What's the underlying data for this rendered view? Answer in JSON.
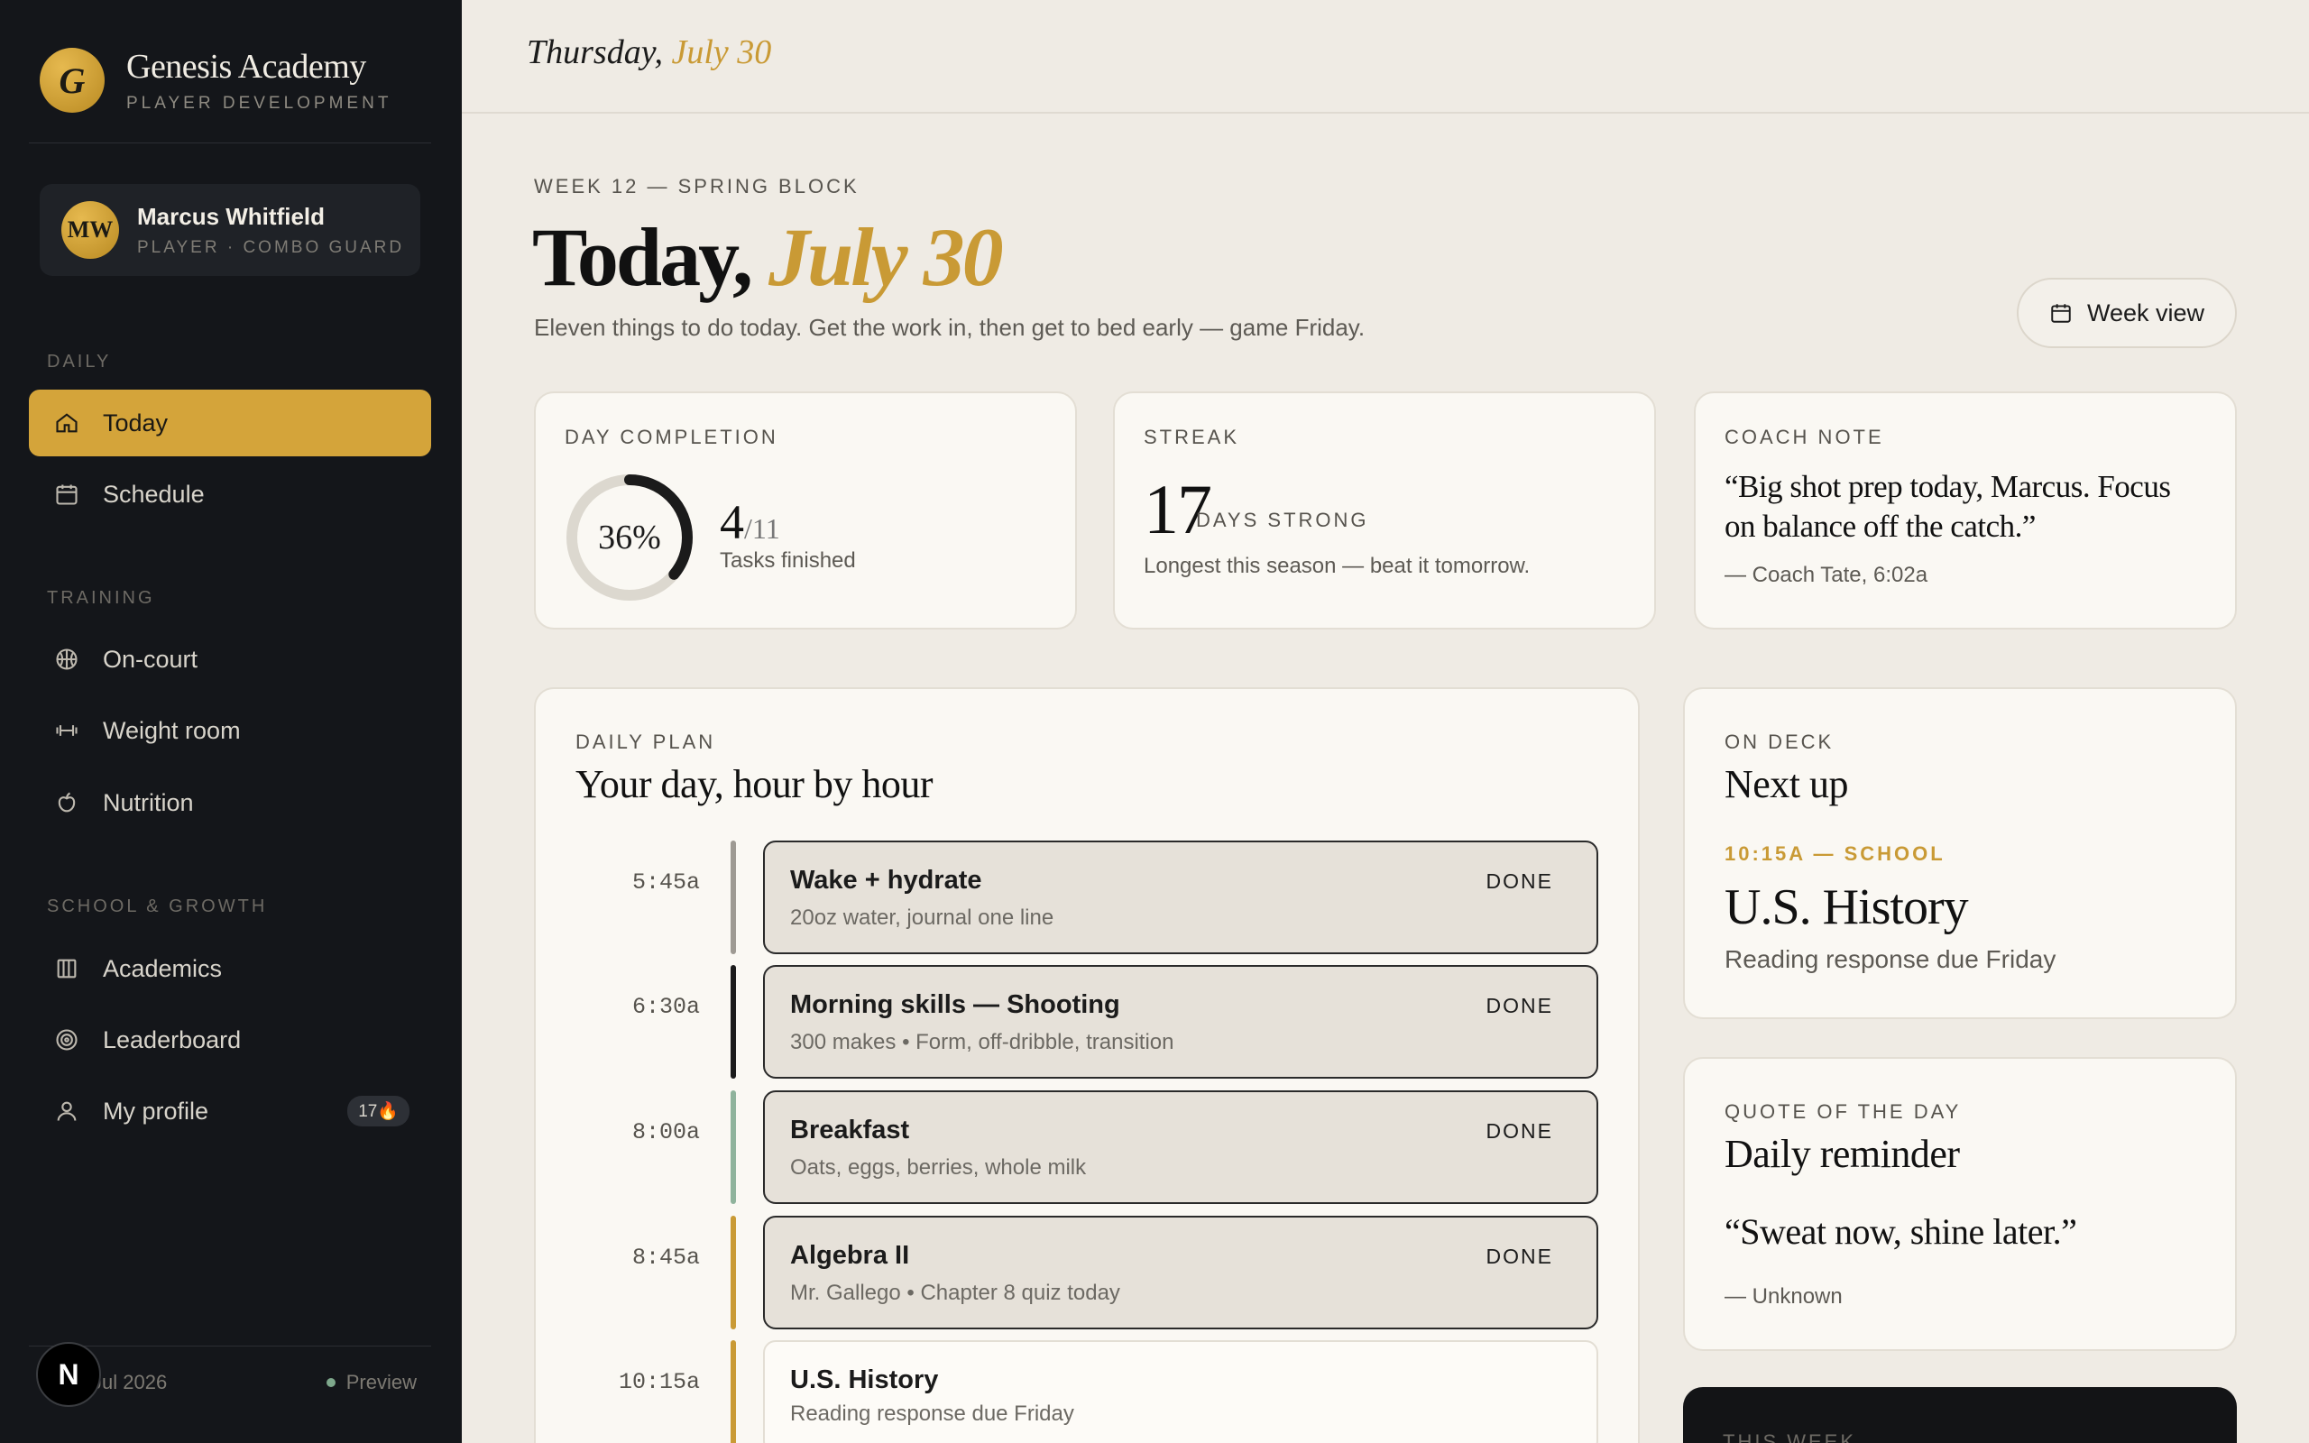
{
  "brand": {
    "logo_letter": "G",
    "name": "Genesis Academy",
    "subtitle": "PLAYER DEVELOPMENT"
  },
  "user": {
    "initials": "MW",
    "name": "Marcus Whitfield",
    "role": "PLAYER · COMBO GUARD"
  },
  "sidebar": {
    "sections": [
      {
        "label": "DAILY"
      },
      {
        "label": "TRAINING"
      },
      {
        "label": "SCHOOL & GROWTH"
      }
    ],
    "items": [
      {
        "label": "Today",
        "icon": "home-icon",
        "active": true
      },
      {
        "label": "Schedule",
        "icon": "calendar-icon"
      },
      {
        "label": "On-court",
        "icon": "basketball-icon"
      },
      {
        "label": "Weight room",
        "icon": "dumbbell-icon"
      },
      {
        "label": "Nutrition",
        "icon": "apple-icon"
      },
      {
        "label": "Academics",
        "icon": "book-icon"
      },
      {
        "label": "Leaderboard",
        "icon": "target-icon"
      },
      {
        "label": "My profile",
        "icon": "user-icon",
        "badge": "17🔥"
      }
    ],
    "footer": {
      "left": "Jul 2026",
      "right": "Preview",
      "n_button": "N"
    }
  },
  "topbar": {
    "weekday": "Thursday,",
    "date": "July 30"
  },
  "hero": {
    "eyebrow": "WEEK 12 — SPRING BLOCK",
    "title_prefix": "Today,",
    "title_accent": "July 30",
    "subtitle": "Eleven things to do today. Get the work in, then get to bed early — game Friday.",
    "week_button": "Week view"
  },
  "stats": {
    "completion": {
      "label": "DAY COMPLETION",
      "percent": 36,
      "percent_text": "36%",
      "done": "4",
      "total": "/11",
      "caption": "Tasks finished"
    },
    "streak": {
      "label": "STREAK",
      "value": "17",
      "unit": "DAYS STRONG",
      "caption": "Longest this season — beat it tomorrow."
    },
    "coach": {
      "label": "COACH NOTE",
      "quote": "“Big shot prep today, Marcus. Focus on balance off the catch.”",
      "author": "— Coach Tate, 6:02a"
    }
  },
  "plan": {
    "eyebrow": "DAILY PLAN",
    "title": "Your day, hour by hour",
    "rows": [
      {
        "time": "5:45a",
        "title": "Wake + hydrate",
        "sub": "20oz water, journal one line",
        "status": "DONE",
        "color": "#9e9a93"
      },
      {
        "time": "6:30a",
        "title": "Morning skills — Shooting",
        "sub": "300 makes • Form, off-dribble, transition",
        "status": "DONE",
        "color": "#1b1b1b"
      },
      {
        "time": "8:00a",
        "title": "Breakfast",
        "sub": "Oats, eggs, berries, whole milk",
        "status": "DONE",
        "color": "#8fb39c"
      },
      {
        "time": "8:45a",
        "title": "Algebra II",
        "sub": "Mr. Gallego • Chapter 8 quiz today",
        "status": "DONE",
        "color": "#c99a35"
      },
      {
        "time": "10:15a",
        "title": "U.S. History",
        "sub": "Reading response due Friday",
        "status": "",
        "color": "#c99a35"
      }
    ]
  },
  "on_deck": {
    "eyebrow": "ON DECK",
    "title": "Next up",
    "time": "10:15A — SCHOOL",
    "item": "U.S. History",
    "sub": "Reading response due Friday"
  },
  "quote_of_day": {
    "eyebrow": "QUOTE OF THE DAY",
    "title": "Daily reminder",
    "quote": "“Sweat now, shine later.”",
    "author": "— Unknown"
  },
  "this_week": {
    "eyebrow": "THIS WEEK"
  }
}
